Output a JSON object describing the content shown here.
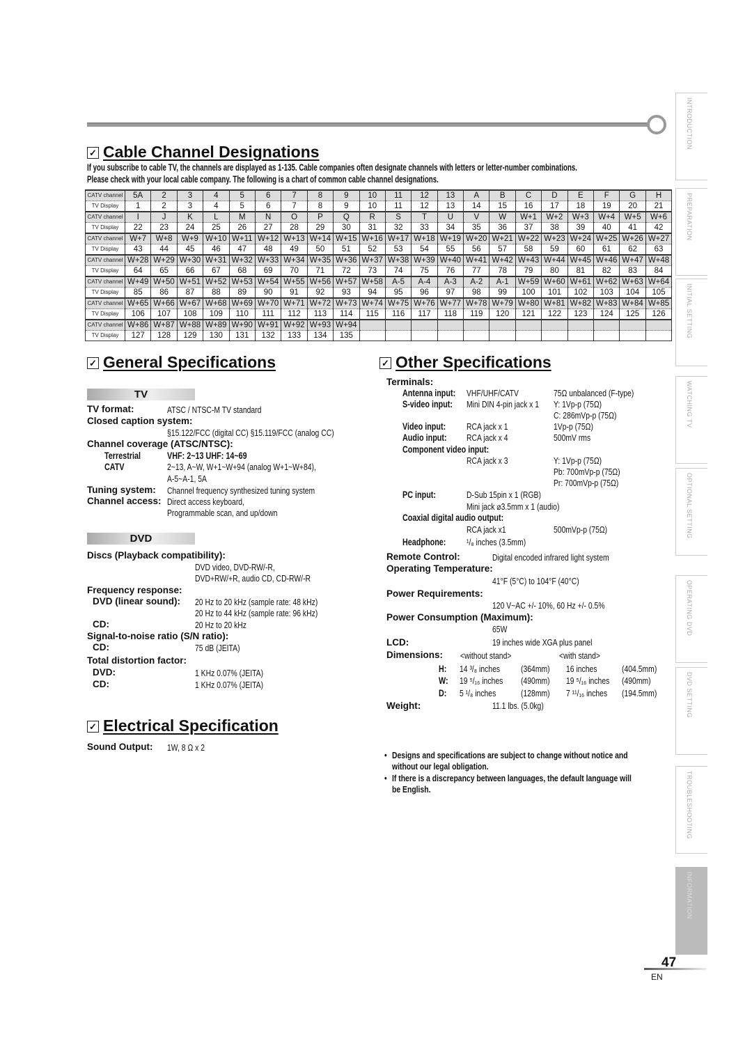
{
  "sidebar": {
    "tabs": [
      {
        "label": "INTRODUCTION",
        "active": false
      },
      {
        "label": "PREPARATION",
        "active": false
      },
      {
        "label": "INITIAL  SETTING",
        "active": false
      },
      {
        "label": "WATCHING  TV",
        "active": false
      },
      {
        "label": "OPTIONAL  SETTING",
        "active": false
      },
      {
        "label": "OPERATING  DVD",
        "active": false
      },
      {
        "label": "DVD  SETTING",
        "active": false
      },
      {
        "label": "TROUBLESHOOTING",
        "active": false
      },
      {
        "label": "INFORMATION",
        "active": true
      }
    ]
  },
  "cable": {
    "title": "Cable Channel Designations",
    "intro_line1": "If you subscribe to cable TV, the channels are displayed as 1-135. Cable companies often designate channels with letters or letter-number combinations.",
    "intro_line2": "Please check with your local cable company. The following is a chart of common cable channel designations.",
    "catv_label": "CATV channel",
    "tv_label": "TV Display",
    "rows": [
      {
        "catv": [
          "5A",
          "2",
          "3",
          "4",
          "5",
          "6",
          "7",
          "8",
          "9",
          "10",
          "11",
          "12",
          "13",
          "A",
          "B",
          "C",
          "D",
          "E",
          "F",
          "G",
          "H"
        ],
        "tv": [
          "1",
          "2",
          "3",
          "4",
          "5",
          "6",
          "7",
          "8",
          "9",
          "10",
          "11",
          "12",
          "13",
          "14",
          "15",
          "16",
          "17",
          "18",
          "19",
          "20",
          "21"
        ]
      },
      {
        "catv": [
          "I",
          "J",
          "K",
          "L",
          "M",
          "N",
          "O",
          "P",
          "Q",
          "R",
          "S",
          "T",
          "U",
          "V",
          "W",
          "W+1",
          "W+2",
          "W+3",
          "W+4",
          "W+5",
          "W+6"
        ],
        "tv": [
          "22",
          "23",
          "24",
          "25",
          "26",
          "27",
          "28",
          "29",
          "30",
          "31",
          "32",
          "33",
          "34",
          "35",
          "36",
          "37",
          "38",
          "39",
          "40",
          "41",
          "42"
        ]
      },
      {
        "catv": [
          "W+7",
          "W+8",
          "W+9",
          "W+10",
          "W+11",
          "W+12",
          "W+13",
          "W+14",
          "W+15",
          "W+16",
          "W+17",
          "W+18",
          "W+19",
          "W+20",
          "W+21",
          "W+22",
          "W+23",
          "W+24",
          "W+25",
          "W+26",
          "W+27"
        ],
        "tv": [
          "43",
          "44",
          "45",
          "46",
          "47",
          "48",
          "49",
          "50",
          "51",
          "52",
          "53",
          "54",
          "55",
          "56",
          "57",
          "58",
          "59",
          "60",
          "61",
          "62",
          "63"
        ]
      },
      {
        "catv": [
          "W+28",
          "W+29",
          "W+30",
          "W+31",
          "W+32",
          "W+33",
          "W+34",
          "W+35",
          "W+36",
          "W+37",
          "W+38",
          "W+39",
          "W+40",
          "W+41",
          "W+42",
          "W+43",
          "W+44",
          "W+45",
          "W+46",
          "W+47",
          "W+48"
        ],
        "tv": [
          "64",
          "65",
          "66",
          "67",
          "68",
          "69",
          "70",
          "71",
          "72",
          "73",
          "74",
          "75",
          "76",
          "77",
          "78",
          "79",
          "80",
          "81",
          "82",
          "83",
          "84"
        ]
      },
      {
        "catv": [
          "W+49",
          "W+50",
          "W+51",
          "W+52",
          "W+53",
          "W+54",
          "W+55",
          "W+56",
          "W+57",
          "W+58",
          "A-5",
          "A-4",
          "A-3",
          "A-2",
          "A-1",
          "W+59",
          "W+60",
          "W+61",
          "W+62",
          "W+63",
          "W+64"
        ],
        "tv": [
          "85",
          "86",
          "87",
          "88",
          "89",
          "90",
          "91",
          "92",
          "93",
          "94",
          "95",
          "96",
          "97",
          "98",
          "99",
          "100",
          "101",
          "102",
          "103",
          "104",
          "105"
        ]
      },
      {
        "catv": [
          "W+65",
          "W+66",
          "W+67",
          "W+68",
          "W+69",
          "W+70",
          "W+71",
          "W+72",
          "W+73",
          "W+74",
          "W+75",
          "W+76",
          "W+77",
          "W+78",
          "W+79",
          "W+80",
          "W+81",
          "W+82",
          "W+83",
          "W+84",
          "W+85"
        ],
        "tv": [
          "106",
          "107",
          "108",
          "109",
          "110",
          "111",
          "112",
          "113",
          "114",
          "115",
          "116",
          "117",
          "118",
          "119",
          "120",
          "121",
          "122",
          "123",
          "124",
          "125",
          "126"
        ]
      },
      {
        "catv": [
          "W+86",
          "W+87",
          "W+88",
          "W+89",
          "W+90",
          "W+91",
          "W+92",
          "W+93",
          "W+94",
          "",
          "",
          "",
          "",
          "",
          "",
          "",
          "",
          "",
          "",
          "",
          ""
        ],
        "tv": [
          "127",
          "128",
          "129",
          "130",
          "131",
          "132",
          "133",
          "134",
          "135",
          "",
          "",
          "",
          "",
          "",
          "",
          "",
          "",
          "",
          "",
          "",
          ""
        ]
      }
    ]
  },
  "general": {
    "title": "General Specifications",
    "tv": {
      "bar": "TV",
      "format_label": "TV format:",
      "format_value": "ATSC / NTSC-M TV standard",
      "cc_label": "Closed caption system:",
      "cc_value": "§15.122/FCC (digital CC)   §15.119/FCC (analog CC)",
      "coverage_label": "Channel coverage (ATSC/NTSC):",
      "terrestrial_label": "Terrestrial",
      "terrestrial_value": "VHF: 2~13   UHF: 14~69",
      "catv_label": "CATV",
      "catv_value1": "2~13, A~W, W+1~W+94 (analog W+1~W+84),",
      "catv_value2": "A-5~A-1, 5A",
      "tuning_label": "Tuning system:",
      "tuning_value": "Channel frequency synthesized tuning system",
      "access_label": "Channel access:",
      "access_value1": "Direct access keyboard,",
      "access_value2": "Programmable scan, and up/down"
    },
    "dvd": {
      "bar": "DVD",
      "discs_label": "Discs (Playback compatibility):",
      "discs_value1": "DVD video, DVD-RW/-R,",
      "discs_value2": "DVD+RW/+R, audio CD, CD-RW/-R",
      "freq_label": "Frequency response:",
      "freq_dvd_label": "DVD (linear sound):",
      "freq_dvd_value1": "20 Hz to 20 kHz (sample rate: 48 kHz)",
      "freq_dvd_value2": "20 Hz to 44 kHz (sample rate: 96 kHz)",
      "freq_cd_label": "CD:",
      "freq_cd_value": "20 Hz to 20 kHz",
      "sn_label": "Signal-to-noise ratio (S/N ratio):",
      "sn_cd_label": "CD:",
      "sn_cd_value": "75 dB (JEITA)",
      "thd_label": "Total distortion factor:",
      "thd_dvd_label": "DVD:",
      "thd_dvd_value": "1 KHz  0.07% (JEITA)",
      "thd_cd_label": "CD:",
      "thd_cd_value": "1 KHz  0.07% (JEITA)"
    }
  },
  "electrical": {
    "title": "Electrical Specification",
    "sound_label": "Sound Output:",
    "sound_value": "1W, 8 Ω x 2"
  },
  "other": {
    "title": "Other Specifications",
    "terminals_label": "Terminals:",
    "antenna_label": "Antenna input:",
    "antenna_type": "VHF/UHF/CATV",
    "antenna_spec": "75Ω unbalanced (F-type)",
    "svideo_label": "S-video input:",
    "svideo_type": "Mini DIN 4-pin jack x 1",
    "svideo_spec1": "Y: 1Vp-p (75Ω)",
    "svideo_spec2": "C: 286mVp-p (75Ω)",
    "video_label": "Video input:",
    "video_type": "RCA jack x 1",
    "video_spec": "1Vp-p (75Ω)",
    "audio_label": "Audio input:",
    "audio_type": "RCA jack x 4",
    "audio_spec": "500mV rms",
    "component_label": "Component video input:",
    "component_type": "RCA jack x 3",
    "component_y": "Y:   1Vp-p (75Ω)",
    "component_pb": "Pb: 700mVp-p (75Ω)",
    "component_pr": "Pr:  700mVp-p (75Ω)",
    "pc_label": "PC input:",
    "pc_type1": "D-Sub 15pin x 1 (RGB)",
    "pc_type2": "Mini jack ⌀3.5mm x 1 (audio)",
    "coax_label": "Coaxial digital audio output:",
    "coax_type": "RCA jack x1",
    "coax_spec": "500mVp-p (75Ω)",
    "headphone_label": "Headphone:",
    "headphone_value": "¹/₈ inches (3.5mm)",
    "remote_label": "Remote Control:",
    "remote_value": "Digital encoded infrared light system",
    "temp_label": "Operating Temperature:",
    "temp_value": "41°F (5°C) to 104°F (40°C)",
    "power_label": "Power Requirements:",
    "power_value": "120 V~AC +/- 10%, 60 Hz +/- 0.5%",
    "consumption_label": "Power Consumption (Maximum):",
    "consumption_value": "65W",
    "lcd_label": "LCD:",
    "lcd_value": "19 inches wide XGA plus panel",
    "dimensions_label": "Dimensions:",
    "without_stand": "<without stand>",
    "with_stand": "<with stand>",
    "dims": [
      {
        "axis": "H:",
        "wo_in": "14 ³/₈ inches",
        "wo_mm": "(364mm)",
        "w_in": "16 inches",
        "w_mm": "(404.5mm)"
      },
      {
        "axis": "W:",
        "wo_in": "19 ⁵/₁₆ inches",
        "wo_mm": "(490mm)",
        "w_in": "19 ⁵/₁₆ inches",
        "w_mm": "(490mm)"
      },
      {
        "axis": "D:",
        "wo_in": "5 ¹/₈ inches",
        "wo_mm": "(128mm)",
        "w_in": "7 ¹¹/₁₆ inches",
        "w_mm": "(194.5mm)"
      }
    ],
    "weight_label": "Weight:",
    "weight_value": "11.1 lbs.  (5.0kg)"
  },
  "notes": [
    {
      "line1": "Designs and specifications are subject to change without notice and",
      "line2": "without our legal obligation."
    },
    {
      "line1": "If there is a discrepancy between languages, the default language will",
      "line2": "be English."
    }
  ],
  "footer": {
    "page_number": "47",
    "language": "EN"
  },
  "colors": {
    "tab_active": "#bbbbbb",
    "table_catv_row": "#dddddd"
  }
}
